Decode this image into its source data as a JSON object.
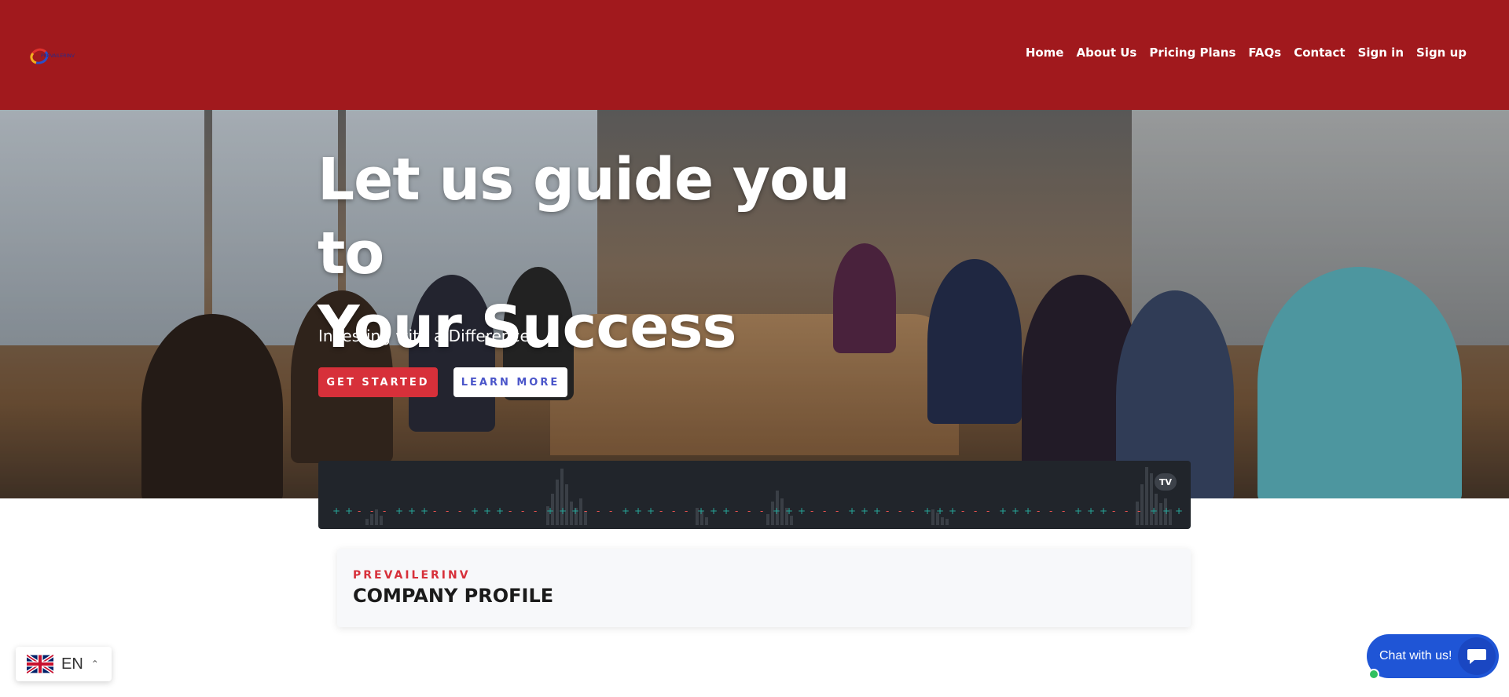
{
  "header": {
    "logo_text": "PREVAILERINV",
    "nav": [
      "Home",
      "About Us",
      "Pricing Plans",
      "FAQs",
      "Contact",
      "Sign in",
      "Sign up"
    ]
  },
  "hero": {
    "title_line1": "Let us guide you to",
    "title_line2": "Your Success",
    "subtitle": "Investing with a Difference",
    "primary_button": "GET STARTED",
    "secondary_button": "LEARN MORE"
  },
  "ticker": {
    "logo": "TV"
  },
  "profile": {
    "kicker": "PREVAILERINV",
    "title": "COMPANY PROFILE"
  },
  "language": {
    "code": "EN",
    "flag_icon": "uk-flag-icon"
  },
  "chat": {
    "label": "Chat with us!",
    "icon": "chat-bubble-icon"
  },
  "colors": {
    "header_bg": "#a1191d",
    "primary": "#d7303a",
    "secondary_text": "#4a55c9",
    "chat": "#1f55d6",
    "ticker_bg": "#21252b"
  }
}
